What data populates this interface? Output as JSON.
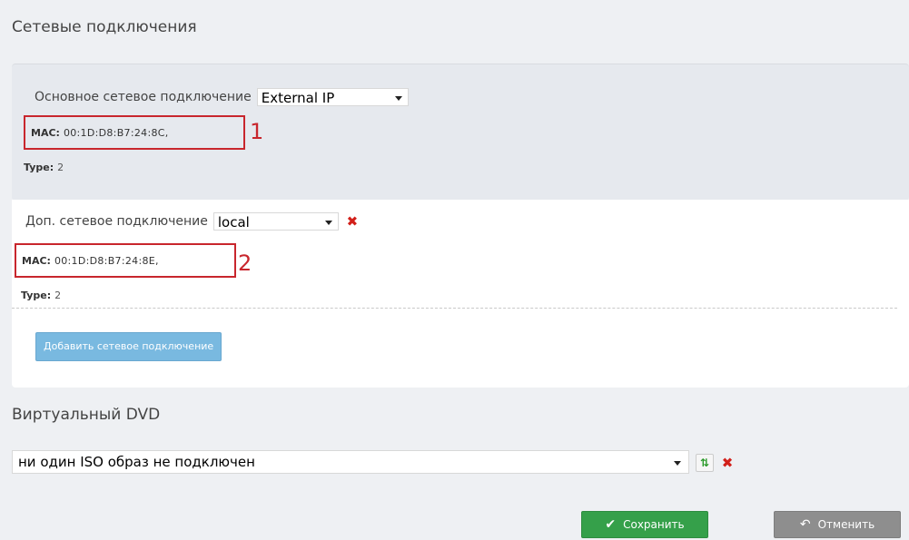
{
  "sections": {
    "network_title": "Сетевые подключения",
    "dvd_title": "Виртуальный DVD"
  },
  "primary": {
    "label": "Основное сетевое подключение",
    "selected": "External IP",
    "mac_label": "MAC:",
    "mac_value": "00:1D:D8:B7:24:8C,",
    "marker": "1",
    "type_label": "Type:",
    "type_value": "2"
  },
  "secondary": {
    "label": "Доп. сетевое подключение",
    "selected": "local",
    "mac_label": "MAC:",
    "mac_value": "00:1D:D8:B7:24:8E,",
    "marker": "2",
    "type_label": "Type:",
    "type_value": "2"
  },
  "add_button": "Добавить сетевое подключение",
  "dvd": {
    "selected": "ни один ISO образ не подключен"
  },
  "actions": {
    "save": "Сохранить",
    "cancel": "Отменить"
  },
  "icons": {
    "delete": "x-icon",
    "refresh": "refresh-icon",
    "save": "check-icon",
    "cancel": "undo-icon"
  },
  "colors": {
    "highlight": "#c8262d",
    "save": "#35a04a",
    "cancel": "#8e8e8e",
    "add": "#79b9e0"
  }
}
